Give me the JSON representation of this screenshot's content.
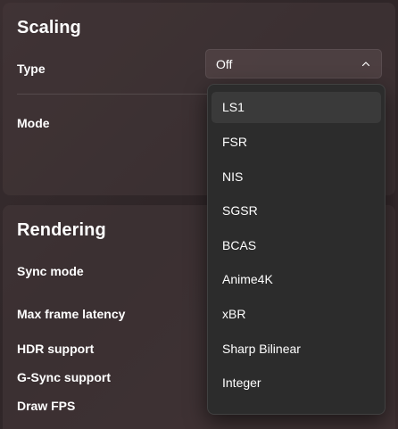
{
  "scaling": {
    "title": "Scaling",
    "type_label": "Type",
    "mode_label": "Mode",
    "type_select": {
      "value": "Off",
      "icon": "chevron-up-icon",
      "options": [
        "LS1",
        "FSR",
        "NIS",
        "SGSR",
        "BCAS",
        "Anime4K",
        "xBR",
        "Sharp Bilinear",
        "Integer"
      ],
      "highlighted": "LS1"
    }
  },
  "rendering": {
    "title": "Rendering",
    "sync_mode_label": "Sync mode",
    "max_frame_latency_label": "Max frame latency",
    "hdr_support_label": "HDR support",
    "gsync_support_label": "G-Sync support",
    "draw_fps_label": "Draw FPS"
  },
  "colors": {
    "background": "#2f2628",
    "card": "#46383a",
    "dropdown": "#2c2c2c",
    "dropdown_highlight": "#3a3a3a",
    "text": "#ffffff"
  }
}
